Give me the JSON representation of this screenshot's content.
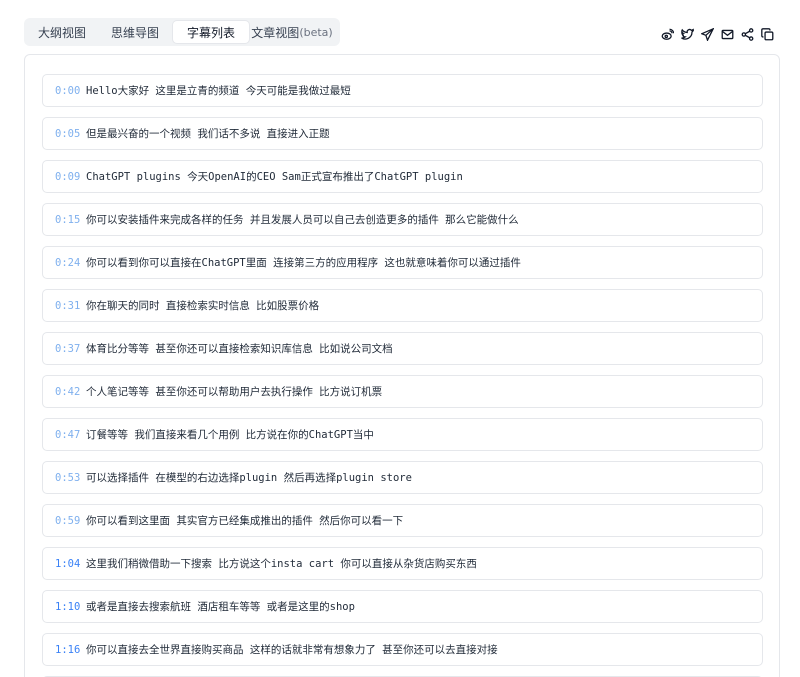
{
  "tabs": [
    {
      "label": "大纲视图"
    },
    {
      "label": "思维导图"
    },
    {
      "label": "字幕列表"
    },
    {
      "label": "文章视图",
      "suffix": "(beta)"
    }
  ],
  "share_icons": [
    "weibo-icon",
    "twitter-icon",
    "telegram-icon",
    "mail-icon",
    "share-icon",
    "copy-icon"
  ],
  "subtitles": [
    {
      "time": "0:00",
      "text": "Hello大家好 这里是立青的频道 今天可能是我做过最短"
    },
    {
      "time": "0:05",
      "text": "但是最兴奋的一个视频 我们话不多说 直接进入正题"
    },
    {
      "time": "0:09",
      "text": "ChatGPT plugins 今天OpenAI的CEO Sam正式宣布推出了ChatGPT plugin"
    },
    {
      "time": "0:15",
      "text": "你可以安装插件来完成各样的任务 并且发展人员可以自己去创造更多的插件 那么它能做什么"
    },
    {
      "time": "0:24",
      "text": "你可以看到你可以直接在ChatGPT里面 连接第三方的应用程序 这也就意味着你可以通过插件"
    },
    {
      "time": "0:31",
      "text": "你在聊天的同时 直接检索实时信息 比如股票价格"
    },
    {
      "time": "0:37",
      "text": "体育比分等等 甚至你还可以直接检索知识库信息 比如说公司文档"
    },
    {
      "time": "0:42",
      "text": "个人笔记等等 甚至你还可以帮助用户去执行操作 比方说订机票"
    },
    {
      "time": "0:47",
      "text": "订餐等等 我们直接来看几个用例 比方说在你的ChatGPT当中"
    },
    {
      "time": "0:53",
      "text": "可以选择插件 在模型的右边选择plugin 然后再选择plugin store"
    },
    {
      "time": "0:59",
      "text": "你可以看到这里面 其实官方已经集成推出的插件 然后你可以看一下"
    },
    {
      "time": "1:04",
      "text": "这里我们稍微借助一下搜索 比方说这个insta cart 你可以直接从杂货店购买东西"
    },
    {
      "time": "1:10",
      "text": "或者是直接去搜索航班 酒店租车等等 或者是这里的shop"
    },
    {
      "time": "1:16",
      "text": "你可以直接去全世界直接购买商品 这样的话就非常有想象力了 甚至你还可以去直接对接"
    }
  ]
}
